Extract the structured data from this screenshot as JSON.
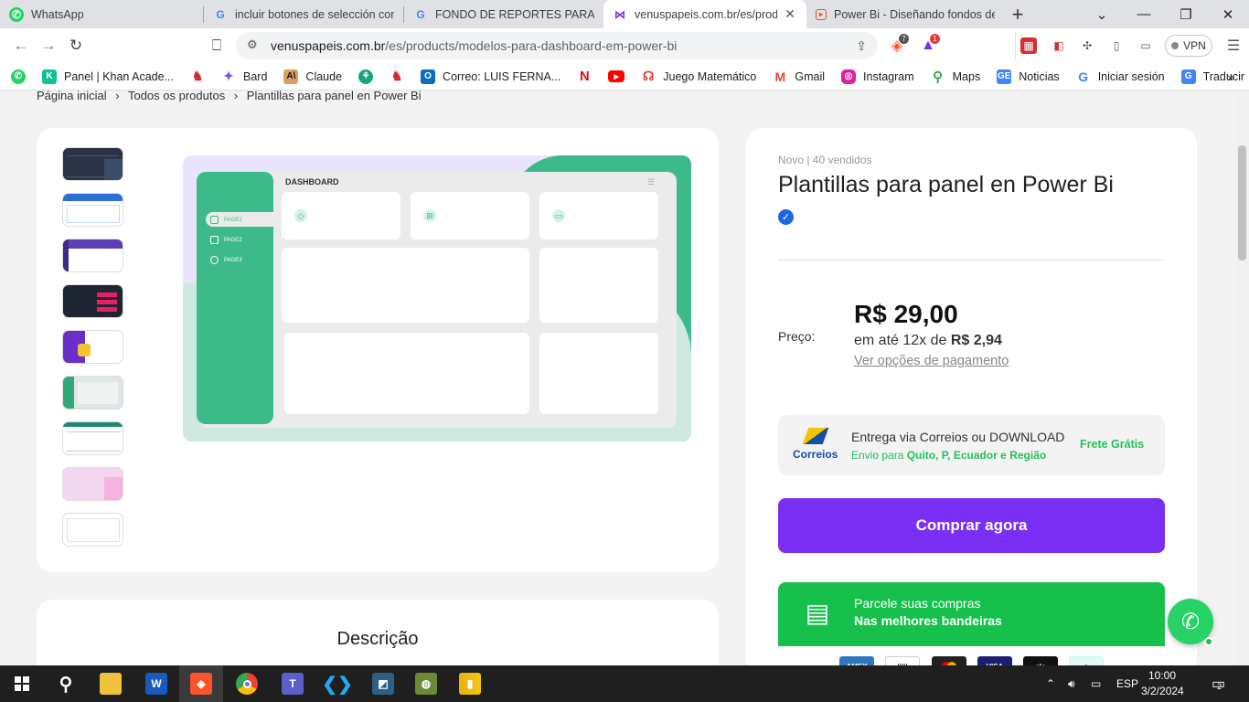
{
  "tabs": [
    {
      "label": "WhatsApp",
      "icon": "whatsapp-icon",
      "color": "#25d366"
    },
    {
      "label": "incluir botones de selección como",
      "icon": "google-icon",
      "color": "#4285f4"
    },
    {
      "label": "FONDO DE REPORTES PARA POWER",
      "icon": "google-icon",
      "color": "#4285f4"
    },
    {
      "label": "venuspapeis.com.br/es/produ",
      "icon": "venus-icon",
      "color": "#7b2ff4",
      "active": true
    },
    {
      "label": "Power Bi - Diseñando fondos de re",
      "icon": "page-icon",
      "color": "#e6522c"
    }
  ],
  "address": {
    "host": "venuspapeis.com.br",
    "path": "/es/products/modelos-para-dashboard-em-power-bi",
    "brave_badge": "7",
    "rewards_badge": "1",
    "vpn_label": "VPN"
  },
  "bookmarks": [
    {
      "label": "",
      "icon": "whatsapp-icon",
      "color": "#25d366"
    },
    {
      "label": "Panel | Khan Acade...",
      "icon": "khan-icon",
      "color": "#14bf96"
    },
    {
      "label": "",
      "icon": "bookmark-red-icon",
      "color": "#d32f2f"
    },
    {
      "label": "Bard",
      "icon": "bard-icon",
      "color": "#7c4dff"
    },
    {
      "label": "Claude",
      "icon": "claude-icon",
      "color": "#d9a15f"
    },
    {
      "label": "",
      "icon": "openai-icon",
      "color": "#19a37f"
    },
    {
      "label": "",
      "icon": "bookmark-red-icon",
      "color": "#d32f2f"
    },
    {
      "label": "Correo: LUIS FERNA...",
      "icon": "outlook-icon",
      "color": "#0f6cbd"
    },
    {
      "label": "",
      "icon": "netflix-icon",
      "color": "#e50914"
    },
    {
      "label": "",
      "icon": "youtube-icon",
      "color": "#ff0000"
    },
    {
      "label": "Juego Matemático",
      "icon": "game-icon",
      "color": "#e53935"
    },
    {
      "label": "Gmail",
      "icon": "gmail-icon",
      "color": "#ea4335"
    },
    {
      "label": "Instagram",
      "icon": "instagram-icon",
      "color": "#d6249f"
    },
    {
      "label": "Maps",
      "icon": "maps-icon",
      "color": "#34a853"
    },
    {
      "label": "Noticias",
      "icon": "news-icon",
      "color": "#4285f4"
    },
    {
      "label": "Iniciar sesión",
      "icon": "google-icon",
      "color": "#4285f4"
    },
    {
      "label": "Traducir",
      "icon": "translate-icon",
      "color": "#4285f4"
    }
  ],
  "breadcrumb": [
    "Página inicial",
    "›",
    "Todos os produtos",
    "›",
    "Plantillas para panel en Power Bi"
  ],
  "preview": {
    "title": "DASHBOARD",
    "pages": [
      "PAGE1",
      "PAGE2",
      "PAGE3"
    ]
  },
  "product": {
    "meta": "Novo | 40 vendidos",
    "title": "Plantillas para panel en Power Bi",
    "price_label": "Preço:",
    "price": "R$ 29,00",
    "installments_prefix": "em até 12x de",
    "installments_value": "R$ 2,94",
    "payment_link": "Ver opções de pagamento",
    "shipping_title": "Entrega via Correios ou DOWNLOAD",
    "shipping_prefix": "Envio para",
    "shipping_dest": "Quito, P, Ecuador e Região",
    "shipping_free": "Frete Grátis",
    "correios": "Correios",
    "buy_label": "Comprar agora",
    "parcel_line1": "Parcele suas compras",
    "parcel_line2": "Nas melhores bandeiras"
  },
  "description_title": "Descrição",
  "taskbar": {
    "time": "10:00",
    "date": "3/2/2024",
    "lang": "ESP",
    "notifications": "2"
  }
}
